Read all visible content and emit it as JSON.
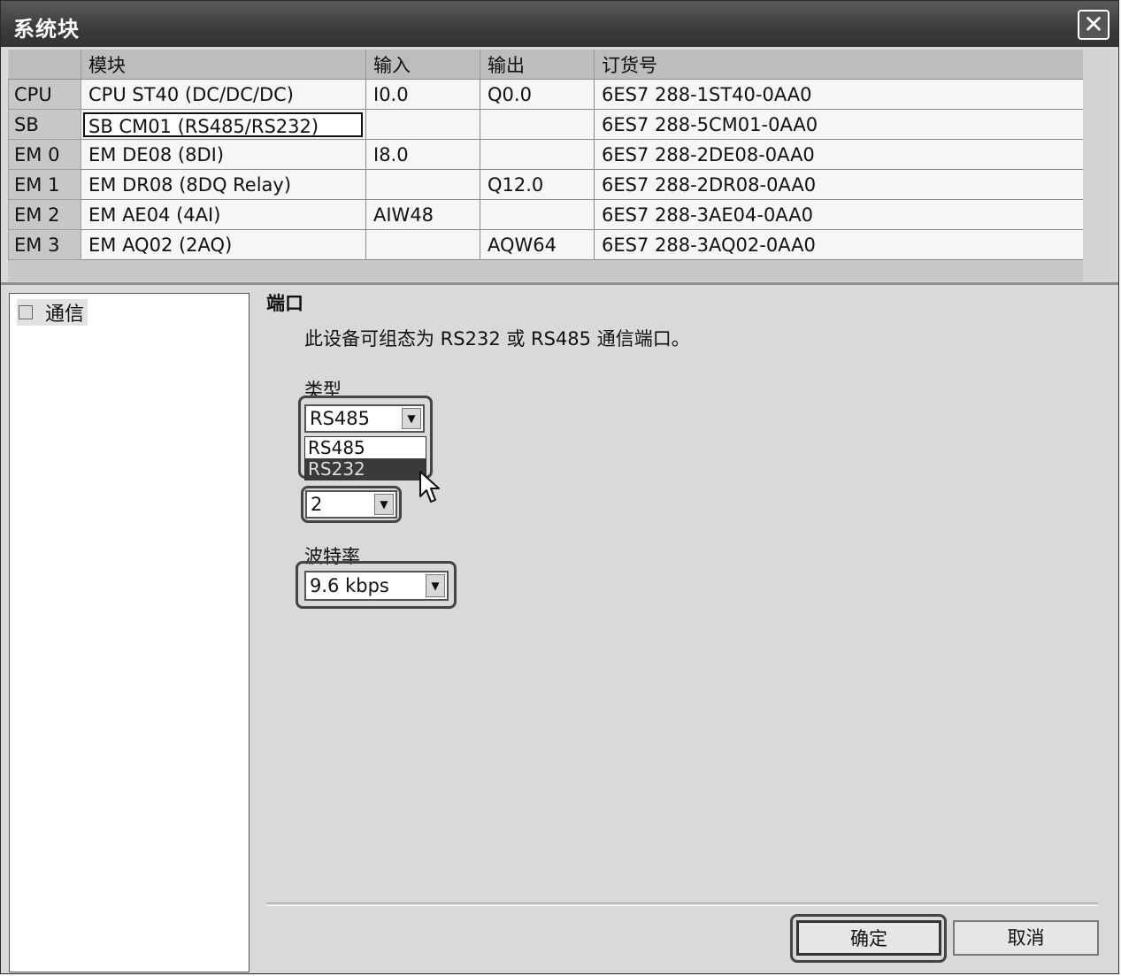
{
  "window": {
    "title": "系统块",
    "close_icon": "close-icon"
  },
  "table": {
    "headers": [
      "",
      "模块",
      "输入",
      "输出",
      "订货号"
    ],
    "rows": [
      {
        "slot": "CPU",
        "module": "CPU ST40 (DC/DC/DC)",
        "input": "I0.0",
        "output": "Q0.0",
        "order": "6ES7 288-1ST40-0AA0"
      },
      {
        "slot": "SB",
        "module": "SB CM01 (RS485/RS232)",
        "input": "",
        "output": "",
        "order": "6ES7 288-5CM01-0AA0"
      },
      {
        "slot": "EM 0",
        "module": "EM DE08 (8DI)",
        "input": "I8.0",
        "output": "",
        "order": "6ES7 288-2DE08-0AA0"
      },
      {
        "slot": "EM 1",
        "module": "EM DR08 (8DQ Relay)",
        "input": "",
        "output": "Q12.0",
        "order": "6ES7 288-2DR08-0AA0"
      },
      {
        "slot": "EM 2",
        "module": "EM AE04 (4AI)",
        "input": "AIW48",
        "output": "",
        "order": "6ES7 288-3AE04-0AA0"
      },
      {
        "slot": "EM 3",
        "module": "EM AQ02 (2AQ)",
        "input": "",
        "output": "AQW64",
        "order": "6ES7 288-3AQ02-0AA0"
      }
    ]
  },
  "tree": {
    "items": [
      {
        "label": "通信",
        "checked": false
      }
    ]
  },
  "port": {
    "title": "端口",
    "description": "此设备可组态为 RS232 或 RS485 通信端口。",
    "type_label": "类型",
    "type_value": "RS485",
    "type_options": [
      "RS485",
      "RS232"
    ],
    "type_hover_option": "RS232",
    "address_value": "2",
    "baud_label": "波特率",
    "baud_value": "9.6 kbps"
  },
  "buttons": {
    "ok": "确定",
    "cancel": "取消"
  },
  "colors": {
    "titlebar": "#3c3c3c",
    "highlight": "#444444",
    "selected_option": "#3a3a3a"
  }
}
